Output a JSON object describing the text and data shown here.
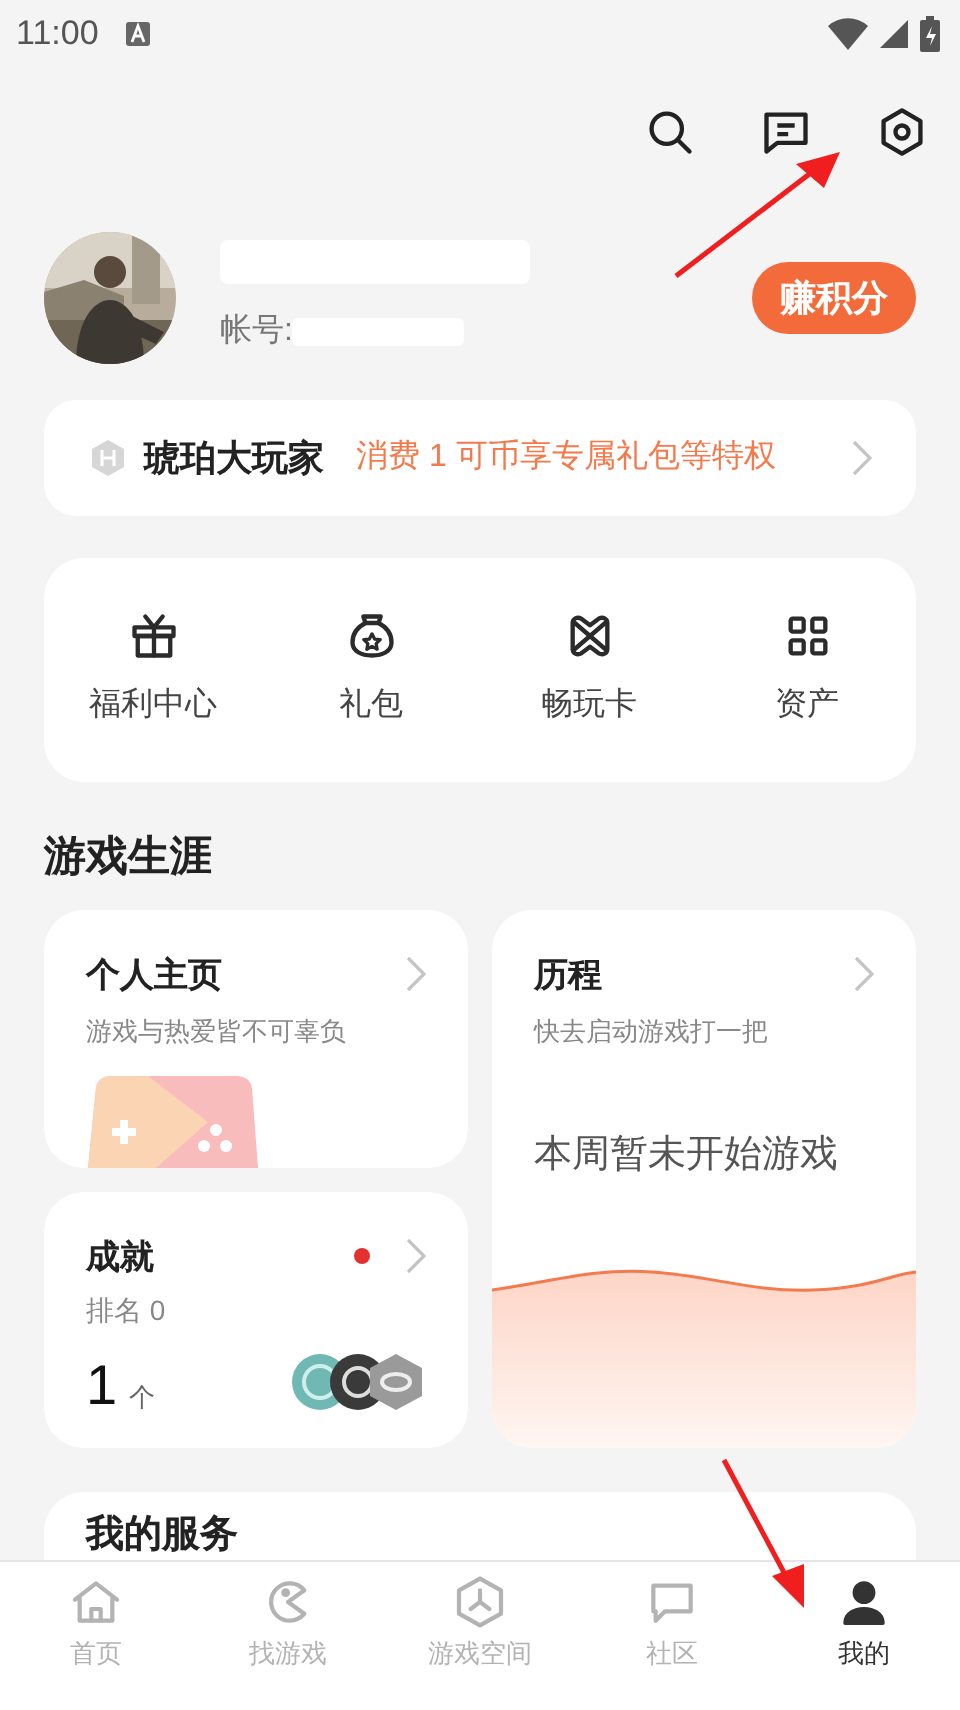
{
  "status_bar": {
    "time": "11:00"
  },
  "profile": {
    "account_label": "帐号:",
    "earn_button": "赚积分"
  },
  "membership": {
    "level": "琥珀大玩家",
    "promo": "消费 1 可币享专属礼包等特权"
  },
  "shortcuts": [
    {
      "label": "福利中心",
      "kind": "gift"
    },
    {
      "label": "礼包",
      "kind": "bag"
    },
    {
      "label": "畅玩卡",
      "kind": "card"
    },
    {
      "label": "资产",
      "kind": "grid"
    }
  ],
  "section_title": "游戏生涯",
  "homepage_card": {
    "title": "个人主页",
    "subtitle": "游戏与热爱皆不可辜负"
  },
  "achievement_card": {
    "title": "成就",
    "subtitle": "排名 0",
    "count": "1",
    "unit": "个",
    "unread": true
  },
  "history_card": {
    "title": "历程",
    "subtitle": "快去启动游戏打一把",
    "empty_message": "本周暂未开始游戏"
  },
  "services": {
    "title": "我的服务"
  },
  "nav": [
    {
      "label": "首页",
      "kind": "home",
      "selected": false
    },
    {
      "label": "找游戏",
      "kind": "find",
      "selected": false
    },
    {
      "label": "游戏空间",
      "kind": "space",
      "selected": false
    },
    {
      "label": "社区",
      "kind": "community",
      "selected": false
    },
    {
      "label": "我的",
      "kind": "me",
      "selected": true
    }
  ]
}
